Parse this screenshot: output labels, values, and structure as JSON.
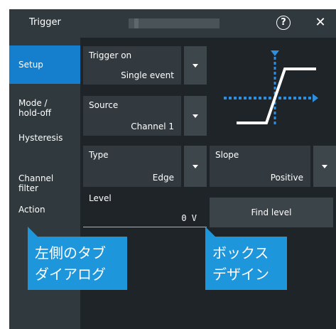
{
  "window": {
    "title": "Trigger",
    "help_glyph": "?",
    "close_glyph": "✕"
  },
  "sidebar": {
    "items": [
      {
        "label": "Setup",
        "active": true
      },
      {
        "label": "Mode /\nhold-off"
      },
      {
        "label": "Hysteresis"
      },
      {
        "label": "Channel\nfilter"
      },
      {
        "label": "Action"
      }
    ]
  },
  "fields": {
    "trigger_on": {
      "label": "Trigger on",
      "value": "Single event"
    },
    "source": {
      "label": "Source",
      "value": "Channel 1"
    },
    "type": {
      "label": "Type",
      "value": "Edge"
    },
    "slope": {
      "label": "Slope",
      "value": "Positive"
    },
    "level": {
      "label": "Level",
      "value": "0 V"
    }
  },
  "buttons": {
    "find_level": "Find level"
  },
  "annotations": {
    "left": {
      "line1": "左側のタブ",
      "line2": "ダイアログ"
    },
    "right": {
      "line1": "ボックス",
      "line2": "デザイン"
    }
  },
  "colors": {
    "accent": "#157fcd",
    "callout": "#1e96dc",
    "trigger_marker": "#2e8fe0"
  },
  "icons": {
    "help": "help-icon",
    "close": "close-icon",
    "dropdown": "dropdown-arrow-icon",
    "edge": "rising-edge-diagram"
  }
}
